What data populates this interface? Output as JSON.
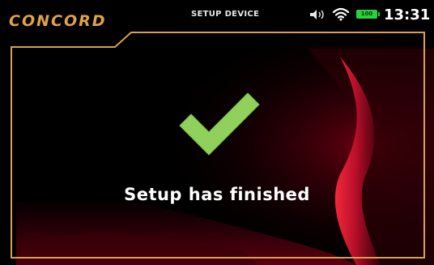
{
  "header": {
    "logo_text": "CONCORD",
    "title": "SETUP DEVICE",
    "icons": [
      "speaker-volume-icon",
      "wifi-icon",
      "battery-icon"
    ],
    "battery_level": "100",
    "clock": "13:31"
  },
  "main": {
    "status_icon": "checkmark-icon",
    "message": "Setup has finished"
  },
  "colors": {
    "accent_gold": "#e0a24a",
    "check_green": "#8fd15a",
    "battery_green": "#2bd13a",
    "background": "#000000",
    "wave_red": "#c8102e"
  }
}
